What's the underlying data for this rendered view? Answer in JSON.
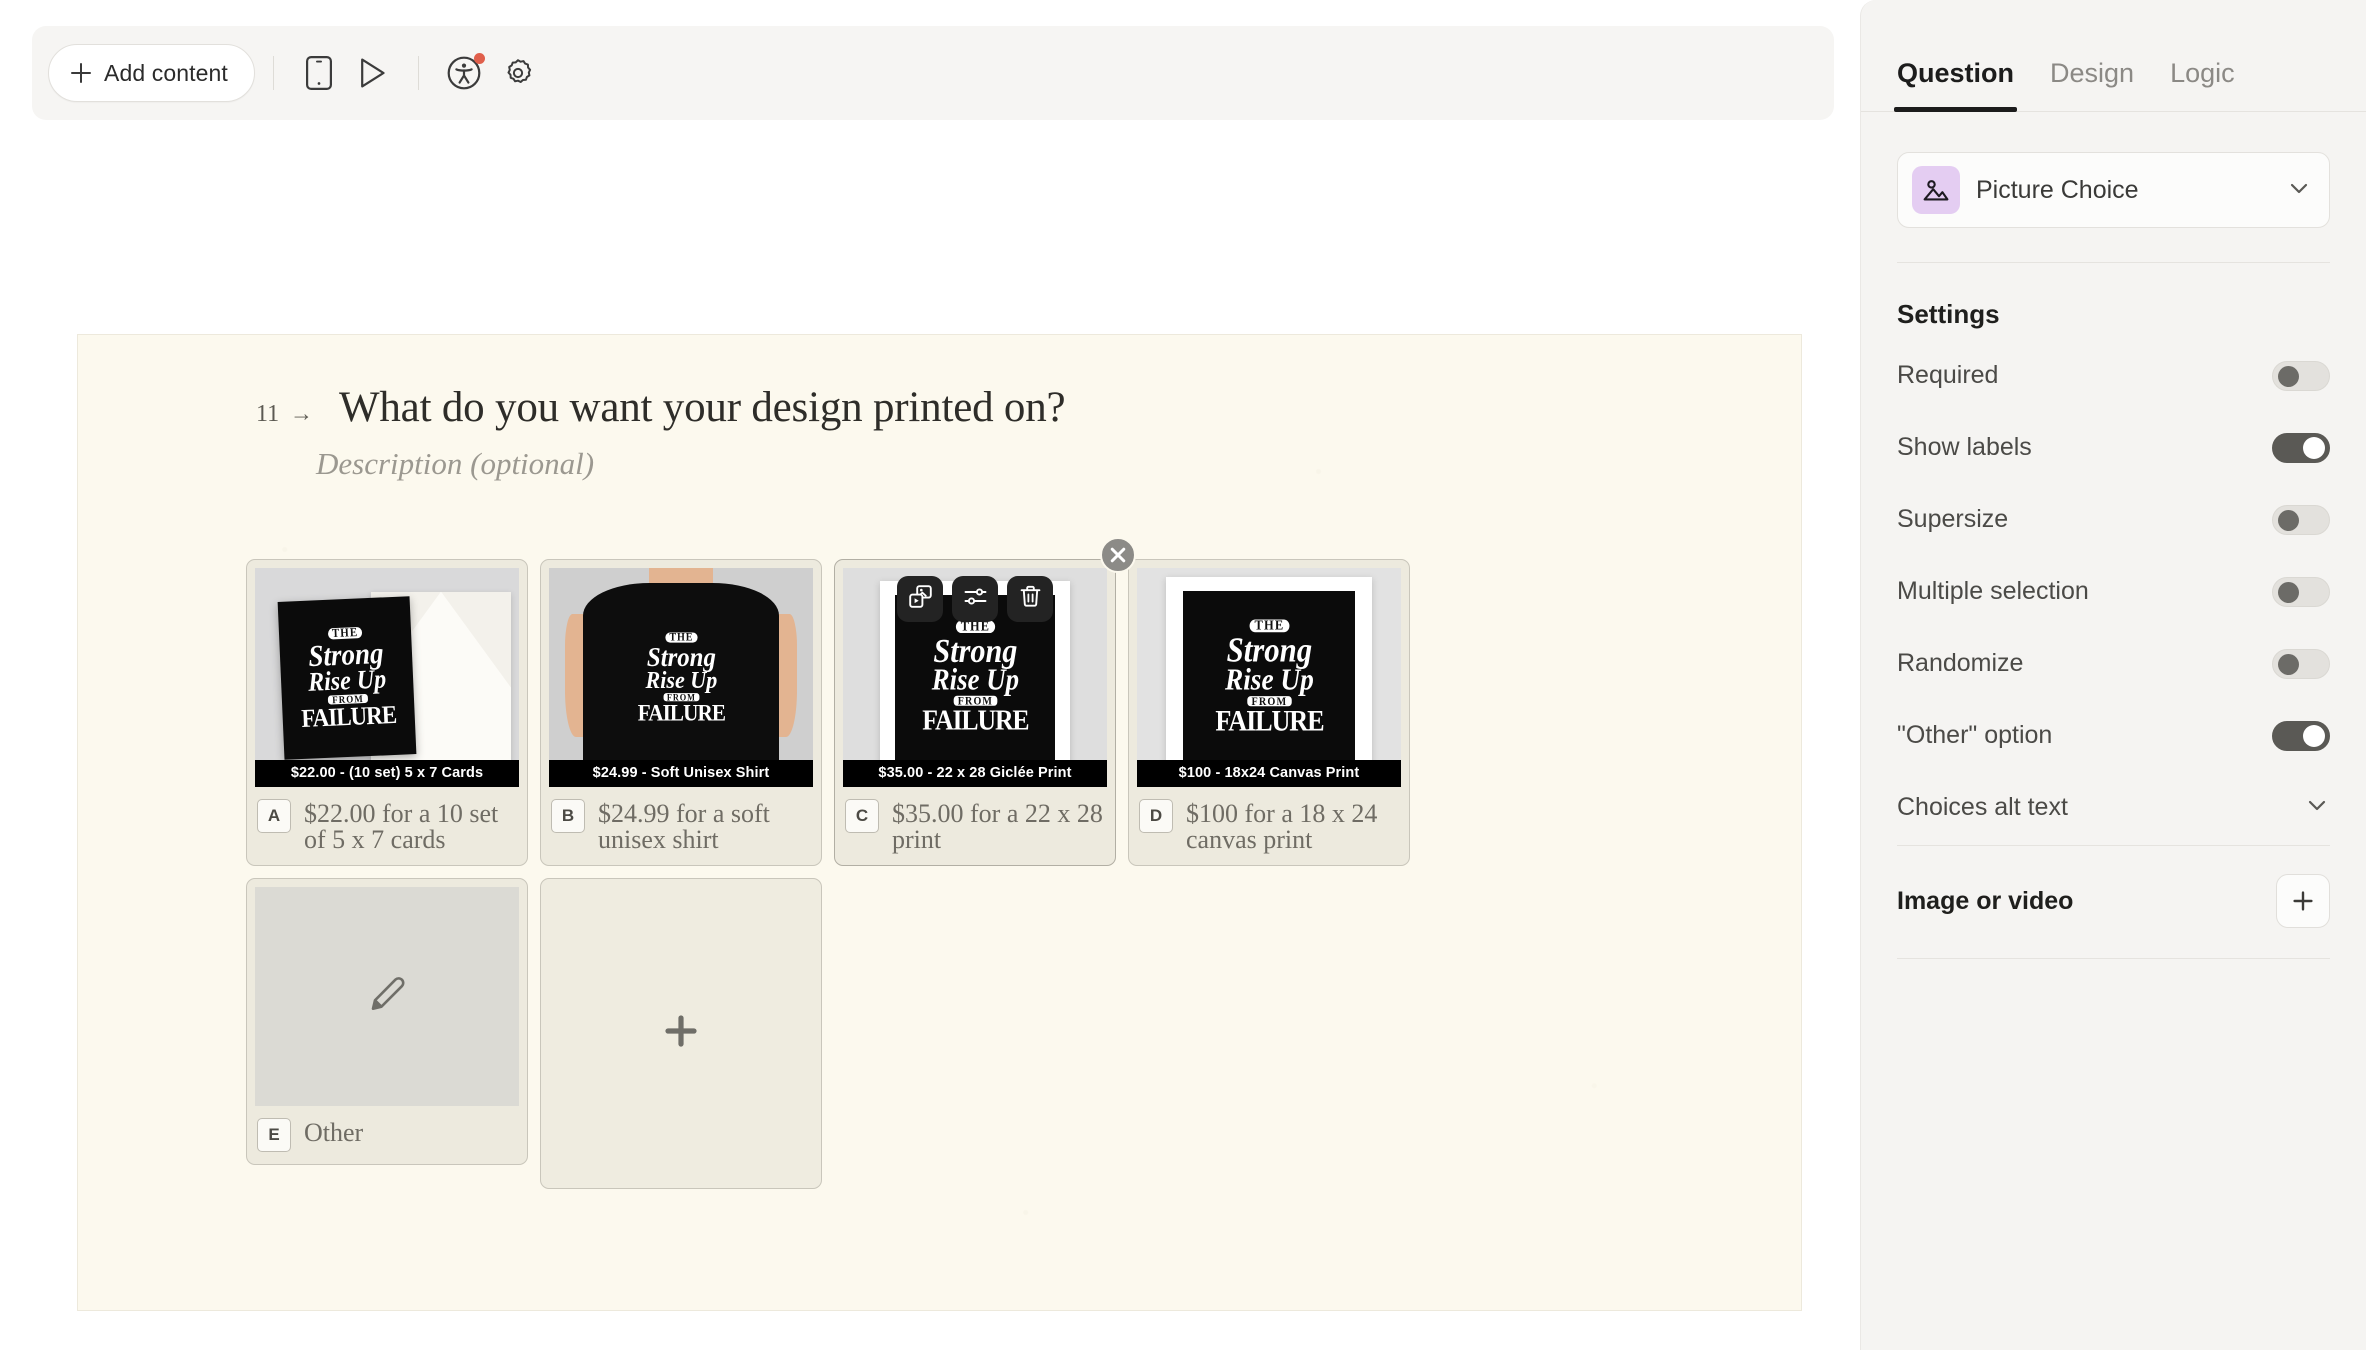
{
  "toolbar": {
    "add_content_label": "Add content",
    "buttons": [
      {
        "name": "mobile-preview",
        "icon": "mobile-icon"
      },
      {
        "name": "play-preview",
        "icon": "play-icon"
      },
      {
        "name": "accessibility",
        "icon": "accessibility-icon",
        "badge": true
      },
      {
        "name": "settings",
        "icon": "gear-icon"
      }
    ]
  },
  "canvas": {
    "question_number": "11",
    "question_arrow": "→",
    "question_title": "What do you want your design printed on?",
    "description_placeholder": "Description (optional)",
    "artwork": {
      "line1": "THE",
      "line2": "Strong",
      "line3": "Rise Up",
      "line4": "FROM",
      "line5": "FAILURE"
    },
    "choices": [
      {
        "key": "A",
        "caption": "$22.00 - (10 set) 5 x 7 Cards",
        "label": "$22.00 for a 10 set of 5 x 7 cards",
        "media": "greeting-card-with-envelope"
      },
      {
        "key": "B",
        "caption": "$24.99 - Soft Unisex Shirt",
        "label": "$24.99 for a soft unisex shirt",
        "media": "black-t-shirt-on-model"
      },
      {
        "key": "C",
        "caption": "$35.00 - 22 x 28 Giclée Print",
        "label": "$35.00 for a 22 x 28 print",
        "media": "framed-giclee-print",
        "active": true
      },
      {
        "key": "D",
        "caption": "$100 - 18x24 Canvas Print",
        "label": "$100 for a 18 x 24 canvas print",
        "media": "framed-canvas-print"
      },
      {
        "key": "E",
        "caption": "",
        "label": "Other",
        "media": "pencil-placeholder"
      }
    ],
    "card_tools": [
      {
        "name": "change-media-button",
        "icon": "image-video-icon"
      },
      {
        "name": "media-settings-button",
        "icon": "sliders-icon"
      },
      {
        "name": "delete-choice-button",
        "icon": "trash-icon"
      }
    ],
    "close_label": "×",
    "add_choice_label": "+"
  },
  "panel": {
    "tabs": [
      {
        "label": "Question",
        "active": true
      },
      {
        "label": "Design",
        "active": false
      },
      {
        "label": "Logic",
        "active": false
      }
    ],
    "question_type": "Picture Choice",
    "settings_title": "Settings",
    "settings": [
      {
        "label": "Required",
        "on": false
      },
      {
        "label": "Show labels",
        "on": true
      },
      {
        "label": "Supersize",
        "on": false
      },
      {
        "label": "Multiple selection",
        "on": false
      },
      {
        "label": "Randomize",
        "on": false
      },
      {
        "label": "\"Other\" option",
        "on": true
      }
    ],
    "choices_alt_text": "Choices alt text",
    "media_label": "Image or video",
    "media_add_label": "+"
  },
  "colors": {
    "accent_badge": "#E05F4B",
    "type_icon_bg": "#E4CDF2",
    "canvas_bg": "#FCF9EE",
    "card_bg": "#EDEADE",
    "panel_bg": "#F5F4F2",
    "toggle_on": "#5A5955"
  }
}
